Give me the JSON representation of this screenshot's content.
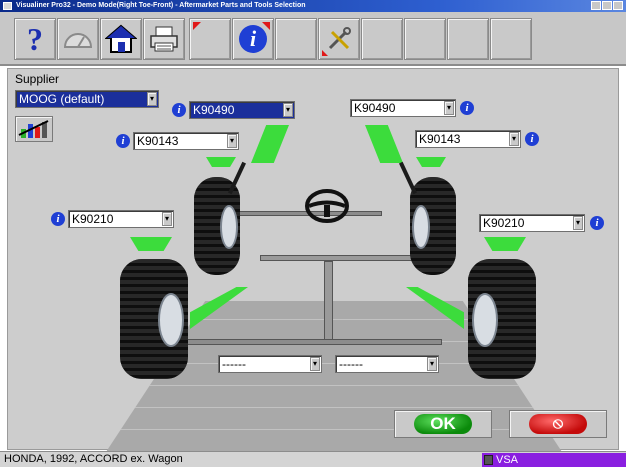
{
  "window": {
    "title": "Visualiner Pro32 - Demo Mode(Right Toe-Front) - Aftermarket Parts and Tools Selection"
  },
  "toolbar": {
    "buttons": [
      {
        "name": "help-button",
        "icon": "question-mark-icon"
      },
      {
        "name": "gauge-button",
        "icon": "gauge-icon"
      },
      {
        "name": "home-button",
        "icon": "home-icon"
      },
      {
        "name": "print-button",
        "icon": "printer-icon"
      },
      {
        "name": "blank-button-1",
        "icon": "none"
      },
      {
        "name": "info-button",
        "icon": "info-icon"
      },
      {
        "name": "blank-button-2",
        "icon": "none"
      },
      {
        "name": "tools-button",
        "icon": "tools-icon"
      },
      {
        "name": "blank-button-3",
        "icon": "none"
      },
      {
        "name": "blank-button-4",
        "icon": "none"
      },
      {
        "name": "blank-button-5",
        "icon": "none"
      },
      {
        "name": "blank-button-6",
        "icon": "none"
      }
    ]
  },
  "supplier": {
    "label": "Supplier",
    "value": "MOOG (default)"
  },
  "parts": {
    "front_left_upper": "K90490",
    "front_left_lower": "K90143",
    "front_right_upper": "K90490",
    "front_right_lower": "K90143",
    "rear_left": "K90210",
    "rear_right": "K90210",
    "bottom_left": "------",
    "bottom_right": "------"
  },
  "buttons": {
    "ok_label": "OK",
    "cancel_label": "⦸"
  },
  "status": {
    "vehicle": "HONDA, 1992, ACCORD ex. Wagon",
    "region": "VSA"
  },
  "colors": {
    "title_bar": "#0a2a8a",
    "indicator_green": "#3cdc3c",
    "selected_dropdown": "#1b2f9b",
    "info_icon": "#1f3fd4",
    "ok_button": "#0b8a0b",
    "cancel_button": "#c40a0a",
    "status_badge": "#8a1fe0"
  }
}
